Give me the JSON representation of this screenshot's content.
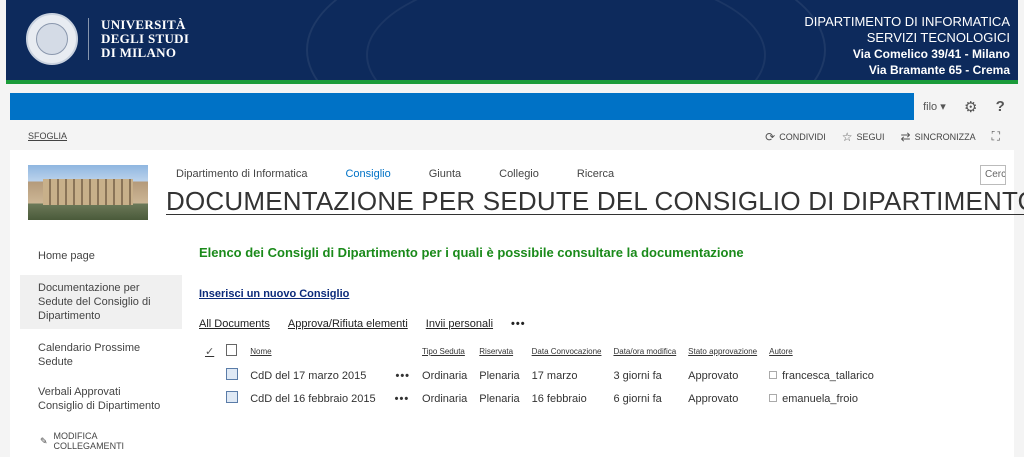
{
  "header": {
    "university_lines": [
      "UNIVERSITÀ",
      "DEGLI STUDI",
      "DI MILANO"
    ],
    "department": "DIPARTIMENTO DI INFORMATICA",
    "service": "SERVIZI TECNOLOGICI",
    "address1": "Via Comelico 39/41 - Milano",
    "address2": "Via Bramante 65 - Crema",
    "accent_green": "#1b9b3a",
    "banner_color": "#0d2a5c"
  },
  "suitebar": {
    "user": "filo",
    "settings_icon": "gear-icon",
    "help_label": "?"
  },
  "ribbon": {
    "browse": "SFOGLIA",
    "share": "CONDIVIDI",
    "follow": "SEGUI",
    "sync": "SINCRONIZZA"
  },
  "topnav": {
    "items": [
      "Dipartimento di Informatica",
      "Consiglio",
      "Giunta",
      "Collegio",
      "Ricerca"
    ],
    "search_placeholder": "Cerca"
  },
  "page_title": "DOCUMENTAZIONE PER SEDUTE DEL CONSIGLIO DI DIPARTIMENTO",
  "leftnav": {
    "items": [
      "Home page",
      "Documentazione per Sedute del Consiglio di Dipartimento",
      "Calendario Prossime Sedute",
      "Verbali Approvati Consiglio di Dipartimento"
    ],
    "edit_links": "MODIFICA COLLEGAMENTI"
  },
  "main": {
    "heading": "Elenco dei Consigli di Dipartimento per i quali è possibile consultare la documentazione",
    "new_link": "Inserisci un nuovo Consiglio",
    "views": [
      "All Documents",
      "Approva/Rifiuta elementi",
      "Invii personali"
    ],
    "more": "•••"
  },
  "table": {
    "columns": [
      "Nome",
      "Tipo Seduta",
      "Riservata",
      "Data Convocazione",
      "Data/ora modifica",
      "Stato approvazione",
      "Autore"
    ],
    "rows": [
      {
        "nome": "CdD del 17 marzo 2015",
        "tipo": "Ordinaria",
        "riservata": "Plenaria",
        "data": "17 marzo",
        "modifica": "3 giorni fa",
        "stato": "Approvato",
        "autore": "francesca_tallarico"
      },
      {
        "nome": "CdD del 16 febbraio 2015",
        "tipo": "Ordinaria",
        "riservata": "Plenaria",
        "data": "16 febbraio",
        "modifica": "6 giorni fa",
        "stato": "Approvato",
        "autore": "emanuela_froio"
      }
    ]
  }
}
